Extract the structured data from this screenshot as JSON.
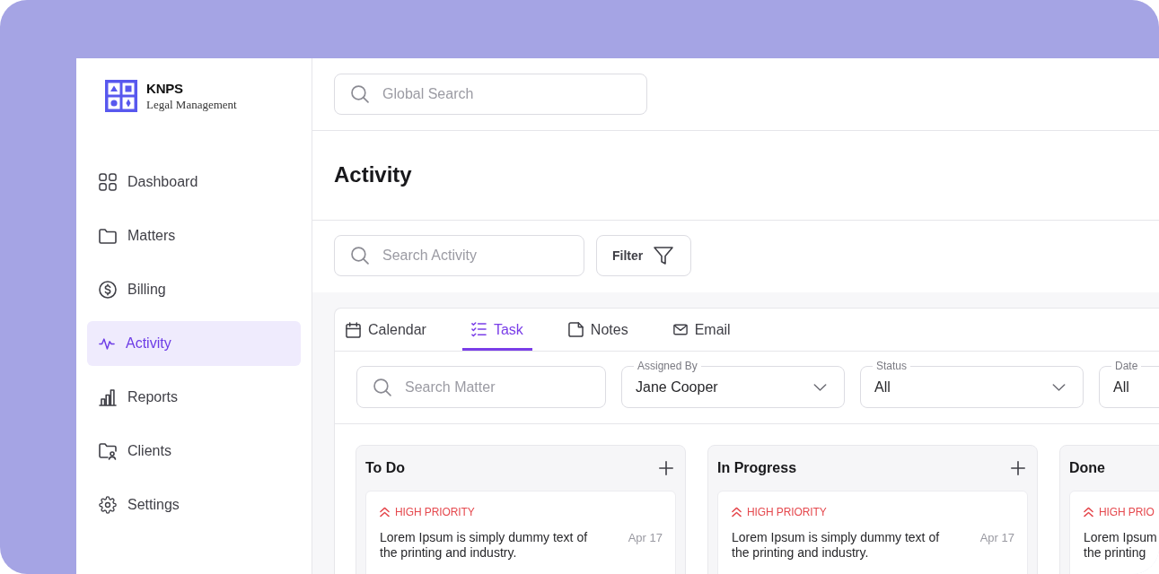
{
  "logo": {
    "name": "KNPS",
    "subtitle": "Legal Management"
  },
  "sidebar": {
    "items": [
      {
        "label": "Dashboard",
        "selected": false
      },
      {
        "label": "Matters",
        "selected": false
      },
      {
        "label": "Billing",
        "selected": false
      },
      {
        "label": "Activity",
        "selected": true
      },
      {
        "label": "Reports",
        "selected": false
      },
      {
        "label": "Clients",
        "selected": false
      },
      {
        "label": "Settings",
        "selected": false
      }
    ]
  },
  "global_search": {
    "placeholder": "Global Search"
  },
  "page_title": "Activity",
  "toolbar": {
    "search": {
      "placeholder": "Search Activity"
    },
    "filter_button": "Filter"
  },
  "tabs": [
    {
      "label": "Calendar",
      "selected": false
    },
    {
      "label": "Task",
      "selected": true
    },
    {
      "label": "Notes",
      "selected": false
    },
    {
      "label": "Email",
      "selected": false
    }
  ],
  "filters": {
    "search": {
      "placeholder": "Search Matter"
    },
    "dropdowns": [
      {
        "label": "Assigned By",
        "value": "Jane Cooper"
      },
      {
        "label": "Status",
        "value": "All"
      },
      {
        "label": "Date",
        "value": "All"
      }
    ]
  },
  "board": {
    "columns": [
      {
        "title": "To Do",
        "cards": [
          {
            "priority": "HIGH PRIORITY",
            "description": "Lorem Ipsum is simply dummy text of\nthe printing and industry.",
            "date": "Apr 17"
          }
        ]
      },
      {
        "title": "In Progress",
        "cards": [
          {
            "priority": "HIGH PRIORITY",
            "description": "Lorem Ipsum is simply dummy text of\nthe printing and industry.",
            "date": "Apr 17"
          }
        ]
      },
      {
        "title": "Done",
        "cards": [
          {
            "priority": "HIGH PRIO",
            "description": "Lorem Ipsum\nthe printing"
          }
        ]
      }
    ]
  }
}
